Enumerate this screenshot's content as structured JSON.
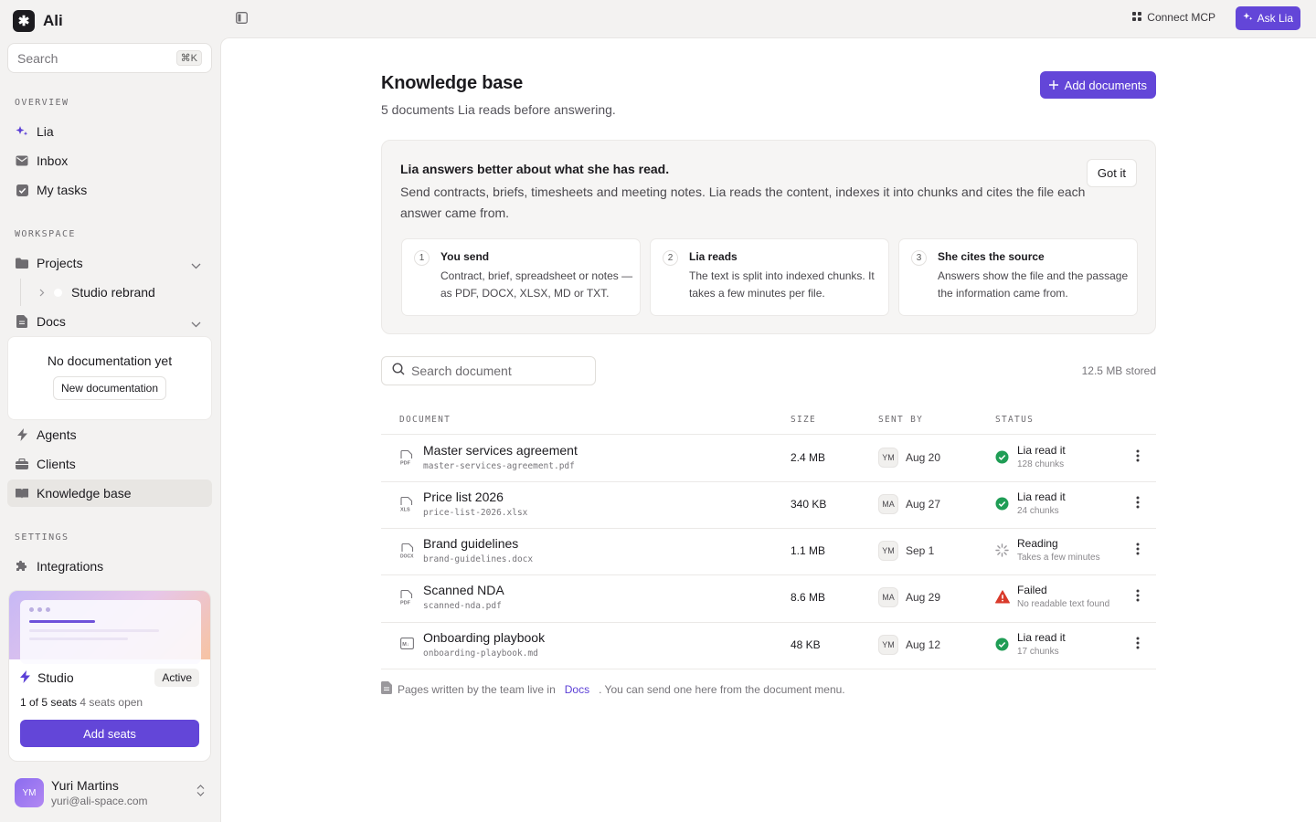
{
  "app": {
    "name": "Ali",
    "logo_glyph": "✱"
  },
  "sidebar": {
    "search_placeholder": "Search",
    "search_shortcut": "⌘K",
    "overview_label": "OVERVIEW",
    "overview_items": [
      {
        "label": "Lia"
      },
      {
        "label": "Inbox"
      },
      {
        "label": "My tasks"
      }
    ],
    "workspace_label": "WORKSPACE",
    "projects_label": "Projects",
    "project_item": "Studio rebrand",
    "docs_label": "Docs",
    "docs_empty_title": "No documentation yet",
    "docs_empty_button": "New documentation",
    "more_items": [
      {
        "label": "Agents"
      },
      {
        "label": "Clients"
      },
      {
        "label": "Knowledge base"
      }
    ],
    "settings_label": "SETTINGS",
    "integrations_label": "Integrations",
    "plan": {
      "name": "Studio",
      "status": "Active",
      "seats_used": "1 of 5 seats",
      "seats_open": "4 seats open",
      "button": "Add seats"
    },
    "user": {
      "initials": "YM",
      "name": "Yuri Martins",
      "email": "yuri@ali-space.com"
    }
  },
  "topbar": {
    "connect_mcp": "Connect MCP",
    "ask_lia": "Ask Lia"
  },
  "page": {
    "title": "Knowledge base",
    "subtitle": "5 documents Lia reads before answering.",
    "add_button": "Add documents"
  },
  "intro": {
    "title": "Lia answers better about what she has read.",
    "desc": "Send contracts, briefs, timesheets and meeting notes. Lia reads the content, indexes it into chunks and cites the file each answer came from.",
    "dismiss": "Got it",
    "steps": [
      {
        "num": "1",
        "title": "You send",
        "desc": "Contract, brief, spreadsheet or notes — as PDF, DOCX, XLSX, MD or TXT."
      },
      {
        "num": "2",
        "title": "Lia reads",
        "desc": "The text is split into indexed chunks. It takes a few minutes per file."
      },
      {
        "num": "3",
        "title": "She cites the source",
        "desc": "Answers show the file and the passage the information came from."
      }
    ]
  },
  "table": {
    "search_placeholder": "Search document",
    "stored": "12.5 MB stored",
    "headers": {
      "document": "DOCUMENT",
      "size": "SIZE",
      "sent_by": "SENT BY",
      "status": "STATUS"
    },
    "rows": [
      {
        "name": "Master services agreement",
        "file": "master-services-agreement.pdf",
        "type": "PDF",
        "size": "2.4 MB",
        "by": "YM",
        "date": "Aug 20",
        "status": "Lia read it",
        "detail": "128 chunks",
        "state": "ok"
      },
      {
        "name": "Price list 2026",
        "file": "price-list-2026.xlsx",
        "type": "XLS",
        "size": "340 KB",
        "by": "MA",
        "date": "Aug 27",
        "status": "Lia read it",
        "detail": "24 chunks",
        "state": "ok"
      },
      {
        "name": "Brand guidelines",
        "file": "brand-guidelines.docx",
        "type": "DOCX",
        "size": "1.1 MB",
        "by": "YM",
        "date": "Sep 1",
        "status": "Reading",
        "detail": "Takes a few minutes",
        "state": "loading"
      },
      {
        "name": "Scanned NDA",
        "file": "scanned-nda.pdf",
        "type": "PDF",
        "size": "8.6 MB",
        "by": "MA",
        "date": "Aug 29",
        "status": "Failed",
        "detail": "No readable text found",
        "state": "error"
      },
      {
        "name": "Onboarding playbook",
        "file": "onboarding-playbook.md",
        "type": "MD",
        "size": "48 KB",
        "by": "YM",
        "date": "Aug 12",
        "status": "Lia read it",
        "detail": "17 chunks",
        "state": "ok"
      }
    ]
  },
  "footer": {
    "before": "Pages written by the team live in",
    "link": "Docs",
    "after": ". You can send one here from the document menu."
  },
  "colors": {
    "accent": "#6346d8",
    "ok": "#1f9d55",
    "error": "#d93a2b"
  }
}
